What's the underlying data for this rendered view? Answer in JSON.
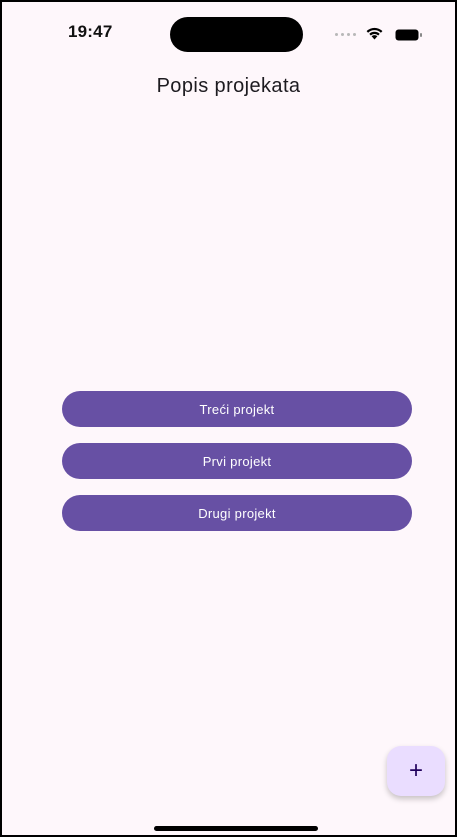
{
  "status_bar": {
    "time": "19:47"
  },
  "header": {
    "title": "Popis projekata"
  },
  "projects": [
    {
      "label": "Treći projekt"
    },
    {
      "label": "Prvi projekt"
    },
    {
      "label": "Drugi projekt"
    }
  ],
  "fab": {
    "label": "+",
    "icon": "plus-icon"
  },
  "colors": {
    "background": "#fef7fb",
    "button": "#6750a4",
    "button_text": "#ffffff",
    "fab_bg": "#eaddff",
    "fab_text": "#21005d"
  }
}
